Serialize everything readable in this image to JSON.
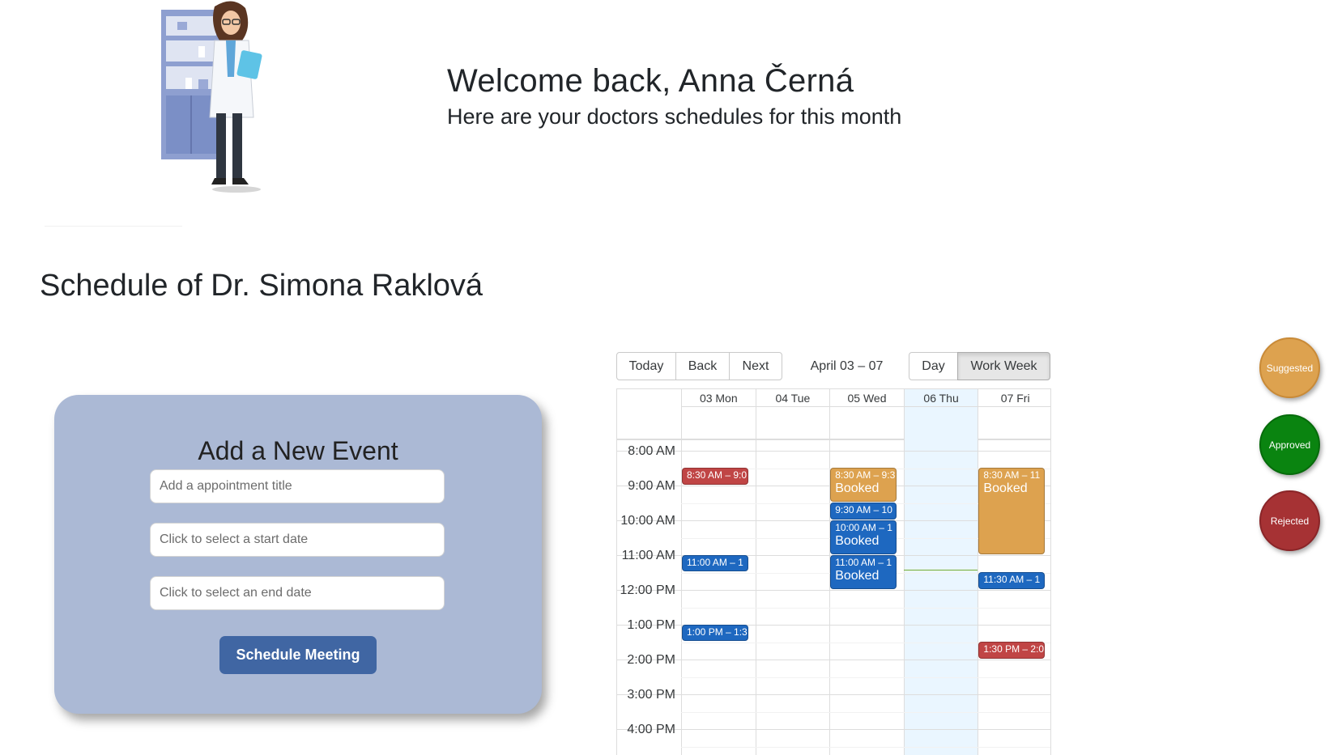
{
  "header": {
    "welcome": "Welcome back, Anna Černá",
    "subtitle": "Here are your doctors schedules for this month",
    "illustration": "doctor-with-clipboard-illustration"
  },
  "schedule": {
    "title": "Schedule of Dr. Simona Raklová"
  },
  "event_form": {
    "title": "Add a New Event",
    "title_placeholder": "Add a appointment title",
    "start_placeholder": "Click to select a start date",
    "end_placeholder": "Click to select an end date",
    "submit_label": "Schedule Meeting"
  },
  "calendar": {
    "nav": {
      "today": "Today",
      "back": "Back",
      "next": "Next"
    },
    "range_label": "April 03 – 07",
    "views": {
      "day": "Day",
      "work_week": "Work Week",
      "active": "Work Week"
    },
    "days": [
      "03 Mon",
      "04 Tue",
      "05 Wed",
      "06 Thu",
      "07 Fri"
    ],
    "today_day": "06 Thu",
    "times": [
      "8:00 AM",
      "9:00 AM",
      "10:00 AM",
      "11:00 AM",
      "12:00 PM",
      "1:00 PM",
      "2:00 PM",
      "3:00 PM",
      "4:00 PM"
    ],
    "events": [
      {
        "day": "03 Mon",
        "start": "8:30",
        "end": "9:00",
        "time_text": "8:30 AM – 9:0",
        "title": "",
        "status": "Rejected"
      },
      {
        "day": "03 Mon",
        "start": "11:00",
        "end": "11:30",
        "time_text": "11:00 AM – 1",
        "title": "",
        "status": "Approved"
      },
      {
        "day": "03 Mon",
        "start": "13:00",
        "end": "13:30",
        "time_text": "1:00 PM – 1:3",
        "title": "",
        "status": "Approved"
      },
      {
        "day": "05 Wed",
        "start": "8:30",
        "end": "9:30",
        "time_text": "8:30 AM – 9:3",
        "title": "Booked",
        "status": "Suggested"
      },
      {
        "day": "05 Wed",
        "start": "9:30",
        "end": "10:00",
        "time_text": "9:30 AM – 10",
        "title": "",
        "status": "Approved"
      },
      {
        "day": "05 Wed",
        "start": "10:00",
        "end": "11:00",
        "time_text": "10:00 AM – 1",
        "title": "Booked",
        "status": "Approved"
      },
      {
        "day": "05 Wed",
        "start": "11:00",
        "end": "12:00",
        "time_text": "11:00 AM – 1",
        "title": "Booked",
        "status": "Approved"
      },
      {
        "day": "07 Fri",
        "start": "8:30",
        "end": "11:00",
        "time_text": "8:30 AM – 11",
        "title": "Booked",
        "status": "Suggested"
      },
      {
        "day": "07 Fri",
        "start": "11:30",
        "end": "12:00",
        "time_text": "11:30 AM – 1",
        "title": "",
        "status": "Approved"
      },
      {
        "day": "07 Fri",
        "start": "13:30",
        "end": "14:00",
        "time_text": "1:30 PM – 2:0",
        "title": "",
        "status": "Rejected"
      }
    ],
    "now_time": "11:25"
  },
  "legend": {
    "suggested": "Suggested",
    "approved": "Approved",
    "rejected": "Rejected"
  },
  "colors": {
    "suggested": "#dda24f",
    "approved": "#0a8410",
    "rejected": "#a63234",
    "booked_blue": "#1e68c0",
    "form_card": "#abb9d5",
    "submit_button": "#4066a3"
  }
}
